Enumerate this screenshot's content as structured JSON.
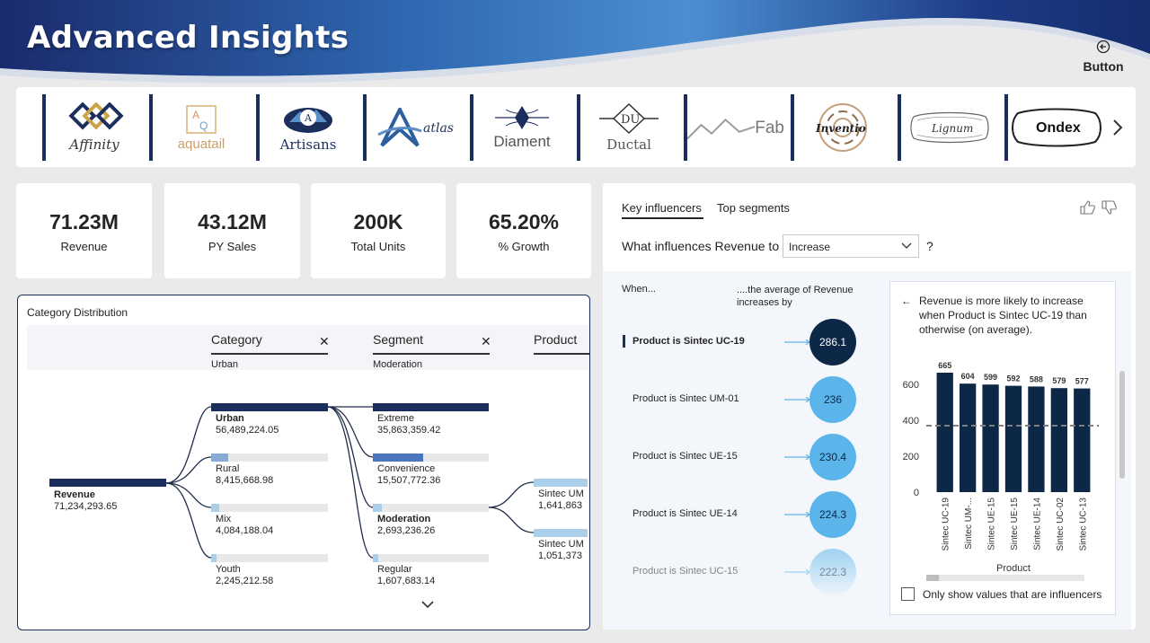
{
  "header": {
    "title": "Advanced Insights",
    "button_label": "Button"
  },
  "logos": [
    {
      "name": "Affinity"
    },
    {
      "name": "aquatail"
    },
    {
      "name": "Artisans"
    },
    {
      "name": "atlas"
    },
    {
      "name": "Diament"
    },
    {
      "name": "Ductal"
    },
    {
      "name": "Fab"
    },
    {
      "name": "Inventio"
    },
    {
      "name": "Lignum"
    },
    {
      "name": "Ondex"
    }
  ],
  "kpis": [
    {
      "value": "71.23M",
      "label": "Revenue"
    },
    {
      "value": "43.12M",
      "label": "PY Sales"
    },
    {
      "value": "200K",
      "label": "Total Units"
    },
    {
      "value": "65.20%",
      "label": "% Growth"
    }
  ],
  "decomp": {
    "title": "Category Distribution",
    "levels": [
      {
        "name": "Category",
        "selected": "Urban"
      },
      {
        "name": "Segment",
        "selected": "Moderation"
      },
      {
        "name": "Product"
      }
    ],
    "root": {
      "label": "Revenue",
      "value": "71,234,293.65"
    },
    "category": [
      {
        "label": "Urban",
        "value": "56,489,224.05",
        "share": 1.0
      },
      {
        "label": "Rural",
        "value": "8,415,668.98",
        "share": 0.149
      },
      {
        "label": "Mix",
        "value": "4,084,188.04",
        "share": 0.072
      },
      {
        "label": "Youth",
        "value": "2,245,212.58",
        "share": 0.04
      }
    ],
    "segment": [
      {
        "label": "Extreme",
        "value": "35,863,359.42",
        "share": 1.0
      },
      {
        "label": "Convenience",
        "value": "15,507,772.36",
        "share": 0.432
      },
      {
        "label": "Moderation",
        "value": "2,693,236.26",
        "share": 0.075
      },
      {
        "label": "Regular",
        "value": "1,607,683.14",
        "share": 0.045
      }
    ],
    "product": [
      {
        "label": "Sintec UM",
        "value": "1,641,863"
      },
      {
        "label": "Sintec UM",
        "value": "1,051,373"
      }
    ]
  },
  "ki": {
    "tabs": [
      "Key influencers",
      "Top segments"
    ],
    "question": "What influences Revenue to",
    "selected": "Increase",
    "qmark": "?",
    "col_when": "When...",
    "col_avg": "....the average of Revenue increases by",
    "influencers": [
      {
        "label": "Product is Sintec UC-19",
        "value": "286.1"
      },
      {
        "label": "Product is Sintec UM-01",
        "value": "236"
      },
      {
        "label": "Product is Sintec UE-15",
        "value": "230.4"
      },
      {
        "label": "Product is Sintec UE-14",
        "value": "224.3"
      },
      {
        "label": "Product is Sintec UC-15",
        "value": "222.3"
      }
    ],
    "detail": {
      "text": "Revenue is more likely to increase when Product is Sintec UC-19 than otherwise (on average).",
      "checkbox_label": "Only show values that are influencers"
    }
  },
  "chart_data": {
    "type": "bar",
    "categories": [
      "Sintec UC-19",
      "Sintec UM-...",
      "Sintec UE-15",
      "Sintec UE-15",
      "Sintec UE-14",
      "Sintec UC-02",
      "Sintec UC-13"
    ],
    "values": [
      665,
      604,
      599,
      592,
      588,
      579,
      577
    ],
    "xlabel": "Product",
    "ylabel": "",
    "ylim": [
      0,
      700
    ],
    "yticks": [
      0,
      200,
      400,
      600
    ],
    "average_line": 370,
    "colors": {
      "bar": "#0d2847",
      "avg": "#7f7f7f"
    }
  },
  "colors": {
    "navy": "#1b2e5c",
    "bubble_light": "#5bb4ea",
    "bubble_dark": "#0d2847",
    "bar_light": "#a9cfeb",
    "bar_mid": "#4b76bf"
  }
}
